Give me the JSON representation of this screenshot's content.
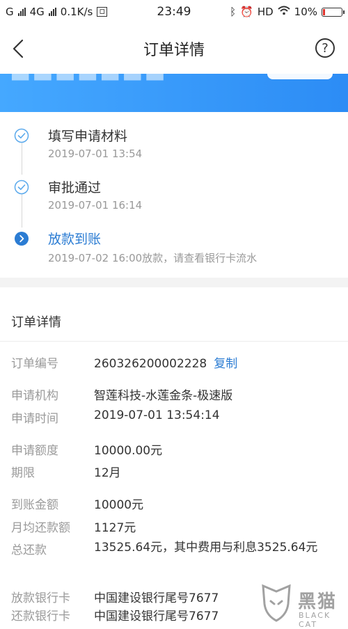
{
  "status_bar": {
    "carrier": "G",
    "network": "4G",
    "speed": "0.1K/s",
    "time": "23:49",
    "hd": "HD",
    "battery_percent": "10%",
    "battery_level": 0.1
  },
  "navbar": {
    "title": "订单详情",
    "help": "?"
  },
  "progress_steps": [
    {
      "label": "填写申请材料",
      "detail": "2019-07-01 13:54",
      "state": "done"
    },
    {
      "label": "审批通过",
      "detail": "2019-07-01 16:14",
      "state": "done"
    },
    {
      "label": "放款到账",
      "detail": "2019-07-02 16:00放款，请查看银行卡流水",
      "state": "current"
    }
  ],
  "order_section": {
    "title": "订单详情",
    "copy_label": "复制",
    "fields": [
      {
        "key": "订单编号",
        "value": "260326200002228"
      },
      {
        "key": "申请机构",
        "value": "智莲科技-水莲金条-极速版"
      },
      {
        "key": "申请时间",
        "value": "2019-07-01 13:54:14"
      },
      {
        "key": "申请额度",
        "value": "10000.00元"
      },
      {
        "key": "期限",
        "value": "12月"
      },
      {
        "key": "到账金额",
        "value": "10000元"
      },
      {
        "key": "月均还款额",
        "value": "1127元"
      },
      {
        "key": "总还款",
        "value": "13525.64元，其中费用与利息3525.64元"
      },
      {
        "key": "放款银行卡",
        "value": "中国建设银行尾号7677"
      },
      {
        "key": "还款银行卡",
        "value": "中国建设银行尾号7677"
      }
    ]
  },
  "watermark": {
    "text": "黑猫",
    "sub": "BLACK CAT"
  },
  "colors": {
    "accent": "#2b7cd3",
    "banner_start": "#45a8ff",
    "banner_end": "#2c8cf5",
    "muted": "#999999"
  }
}
